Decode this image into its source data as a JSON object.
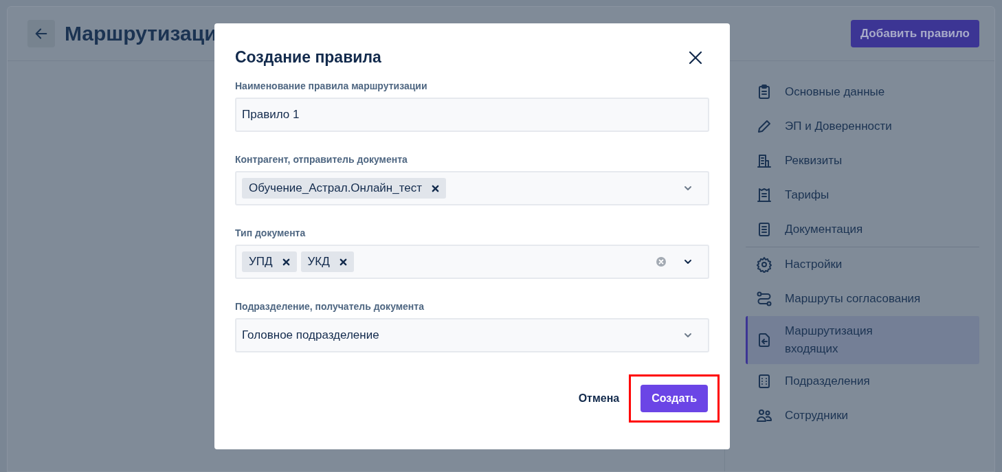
{
  "page": {
    "title": "Маршрутизаци",
    "add_button": "Добавить правило"
  },
  "sidebar": {
    "groups": [
      {
        "items": [
          {
            "label": "Основные данные",
            "selected": false
          },
          {
            "label": "ЭП и Доверенности",
            "selected": false
          },
          {
            "label": "Реквизиты",
            "selected": false
          },
          {
            "label": "Тарифы",
            "selected": false
          },
          {
            "label": "Документация",
            "selected": false
          }
        ]
      },
      {
        "items": [
          {
            "label": "Настройки",
            "selected": false
          },
          {
            "label": "Маршруты согласования",
            "selected": false
          },
          {
            "label": "Маршрутизация входящих",
            "selected": true
          },
          {
            "label": "Подразделения",
            "selected": false
          },
          {
            "label": "Сотрудники",
            "selected": false
          }
        ]
      }
    ]
  },
  "dialog": {
    "title": "Создание правила",
    "fields": [
      {
        "kind": "text",
        "label": "Наименование правила маршрутизации",
        "value": "Правило 1"
      },
      {
        "kind": "multiselect",
        "label": "Контрагент, отправитель документа",
        "tags": [
          "Обучение_Астрал.Онлайн_тест"
        ],
        "clearable": false
      },
      {
        "kind": "multiselect",
        "label": "Тип документа",
        "tags": [
          "УПД",
          "УКД"
        ],
        "clearable": true
      },
      {
        "kind": "select",
        "label": "Подразделение, получатель документа",
        "value": "Головное подразделение"
      }
    ],
    "cancel_button": "Отмена",
    "create_button": {
      "label": "Создать",
      "highlighted": true
    }
  }
}
